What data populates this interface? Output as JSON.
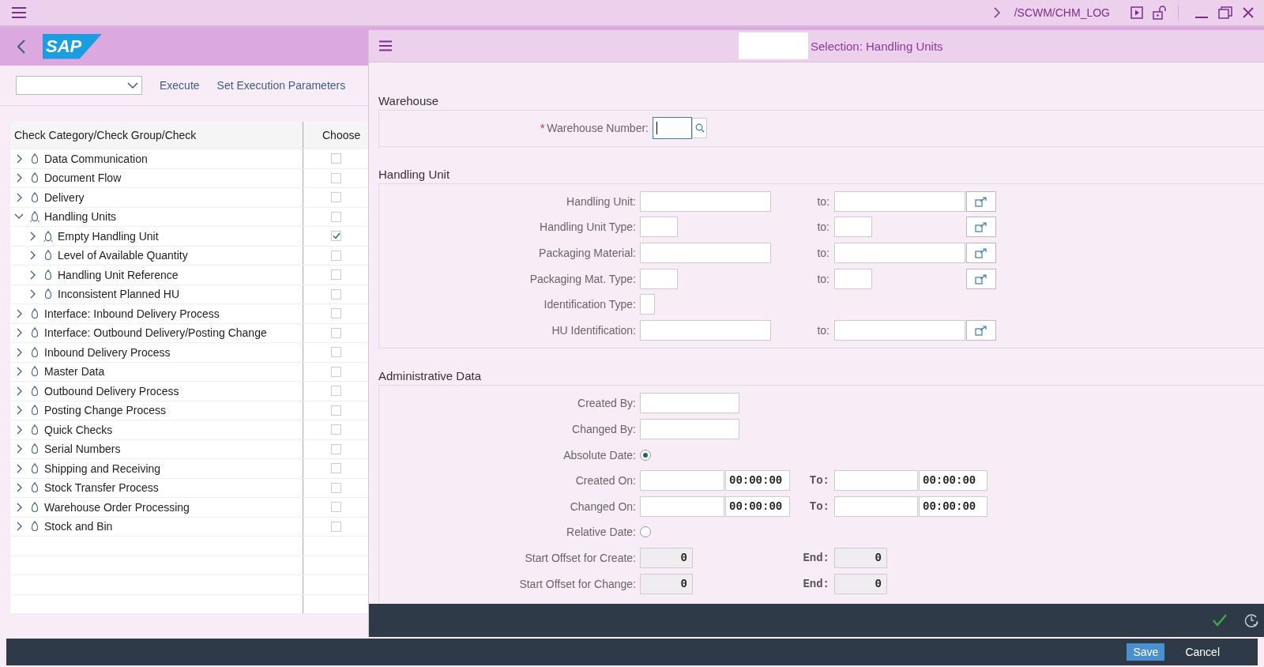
{
  "top_bar": {
    "transaction": "/SCWM/CHM_LOG"
  },
  "header": {
    "logo_text": "SAP"
  },
  "toolbar": {
    "actions": [
      "Execute",
      "Set Execution Parameters"
    ]
  },
  "tree": {
    "columns": [
      "Check Category/Check Group/Check",
      "Choose"
    ],
    "items": [
      {
        "label": "Data Communication",
        "kind": "plain",
        "expanded": false,
        "checked": false
      },
      {
        "label": "Document Flow",
        "kind": "plain",
        "expanded": false,
        "checked": false
      },
      {
        "label": "Delivery",
        "kind": "plain",
        "expanded": false,
        "checked": false
      },
      {
        "label": "Handling Units",
        "kind": "lit",
        "expanded": true,
        "checked": false,
        "children": [
          {
            "label": "Empty Handling Unit",
            "kind": "lit",
            "expanded": false,
            "checked": true
          },
          {
            "label": "Level of Available Quantity",
            "kind": "plain",
            "expanded": false,
            "checked": false
          },
          {
            "label": "Handling Unit Reference",
            "kind": "plain",
            "expanded": false,
            "checked": false
          },
          {
            "label": "Inconsistent Planned HU",
            "kind": "plain",
            "expanded": false,
            "checked": false
          }
        ]
      },
      {
        "label": "Interface: Inbound Delivery Process",
        "kind": "plain",
        "expanded": false,
        "checked": false
      },
      {
        "label": "Interface: Outbound Delivery/Posting Change",
        "kind": "plain",
        "expanded": false,
        "checked": false
      },
      {
        "label": "Inbound Delivery Process",
        "kind": "plain",
        "expanded": false,
        "checked": false
      },
      {
        "label": "Master Data",
        "kind": "plain",
        "expanded": false,
        "checked": false
      },
      {
        "label": "Outbound Delivery Process",
        "kind": "plain",
        "expanded": false,
        "checked": false
      },
      {
        "label": "Posting Change Process",
        "kind": "plain",
        "expanded": false,
        "checked": false
      },
      {
        "label": "Quick Checks",
        "kind": "plain",
        "expanded": false,
        "checked": false
      },
      {
        "label": "Serial Numbers",
        "kind": "plain",
        "expanded": false,
        "checked": false
      },
      {
        "label": "Shipping and Receiving",
        "kind": "plain",
        "expanded": false,
        "checked": false
      },
      {
        "label": "Stock Transfer Process",
        "kind": "plain",
        "expanded": false,
        "checked": false
      },
      {
        "label": "Warehouse Order Processing",
        "kind": "plain",
        "expanded": false,
        "checked": false
      },
      {
        "label": "Stock and Bin",
        "kind": "plain",
        "expanded": false,
        "checked": false
      }
    ]
  },
  "dialog": {
    "title": "Selection: Handling Units",
    "sections": [
      {
        "title": "Warehouse",
        "rows": [
          {
            "kind": "lookup",
            "label": "Warehouse Number:",
            "required_mark": "*"
          }
        ]
      },
      {
        "title": "Handling Unit",
        "rows": [
          {
            "kind": "range",
            "label": "Handling Unit:",
            "to_label": "to:"
          },
          {
            "kind": "coderange",
            "label": "Handling Unit Type:",
            "to_label": "to:"
          },
          {
            "kind": "range",
            "label": "Packaging Material:",
            "to_label": "to:"
          },
          {
            "kind": "coderange",
            "label": "Packaging Mat. Type:",
            "to_label": "to:"
          },
          {
            "kind": "flag",
            "label": "Identification Type:"
          },
          {
            "kind": "range",
            "label": "HU Identification:",
            "to_label": "to:"
          }
        ]
      },
      {
        "title": "Administrative Data",
        "rows": [
          {
            "kind": "single",
            "label": "Created By:"
          },
          {
            "kind": "single",
            "label": "Changed By:"
          },
          {
            "kind": "radio",
            "label": "Absolute Date:",
            "selected": true
          },
          {
            "kind": "datetime",
            "label": "Created On:",
            "time": "00:00:00",
            "to_label": "To:",
            "to_time": "00:00:00"
          },
          {
            "kind": "datetime",
            "label": "Changed On:",
            "time": "00:00:00",
            "to_label": "To:",
            "to_time": "00:00:00"
          },
          {
            "kind": "radio",
            "label": "Relative Date:",
            "selected": false
          },
          {
            "kind": "offset",
            "label": "Start Offset for Create:",
            "value": "0",
            "to_label": "End:",
            "to_value": "0"
          },
          {
            "kind": "offset",
            "label": "Start Offset for Change:",
            "value": "0",
            "to_label": "End:",
            "to_value": "0"
          }
        ]
      }
    ]
  },
  "footer": {
    "buttons": [
      {
        "label": "Save",
        "kind": "primary"
      },
      {
        "label": "Cancel",
        "kind": "plain"
      }
    ]
  }
}
